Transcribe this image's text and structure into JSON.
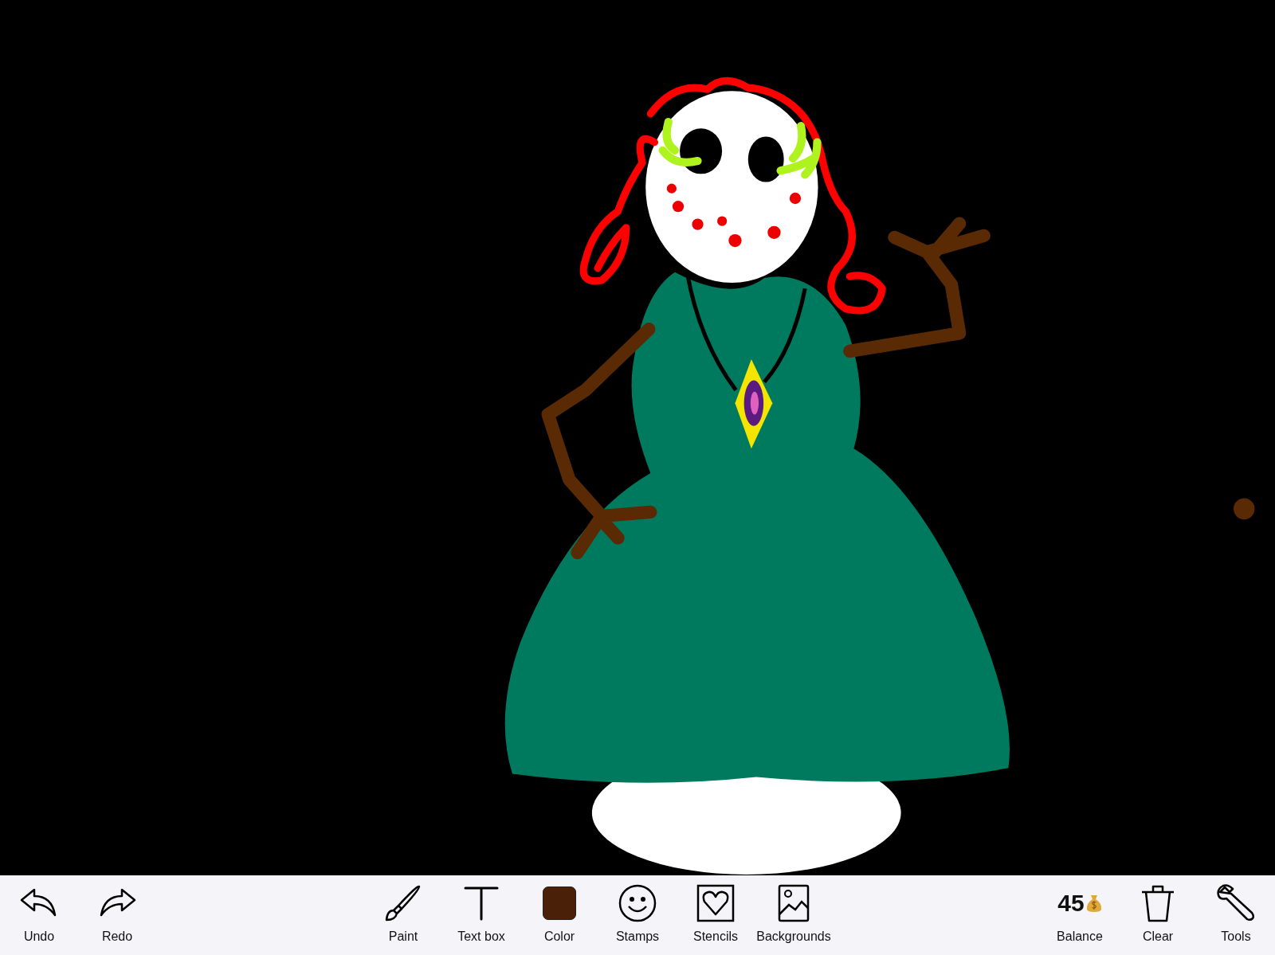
{
  "toolbar": {
    "left": [
      {
        "kind": "undo",
        "label": "Undo"
      },
      {
        "kind": "redo",
        "label": "Redo"
      }
    ],
    "center": [
      {
        "kind": "paint",
        "label": "Paint"
      },
      {
        "kind": "text",
        "label": "Text box"
      },
      {
        "kind": "color",
        "label": "Color",
        "color": "#4a2008"
      },
      {
        "kind": "stamps",
        "label": "Stamps"
      },
      {
        "kind": "stencils",
        "label": "Stencils"
      },
      {
        "kind": "backgrounds",
        "label": "Backgrounds"
      }
    ],
    "right": [
      {
        "kind": "balance",
        "label": "Balance",
        "value": "45"
      },
      {
        "kind": "clear",
        "label": "Clear"
      },
      {
        "kind": "tools",
        "label": "Tools"
      }
    ]
  }
}
